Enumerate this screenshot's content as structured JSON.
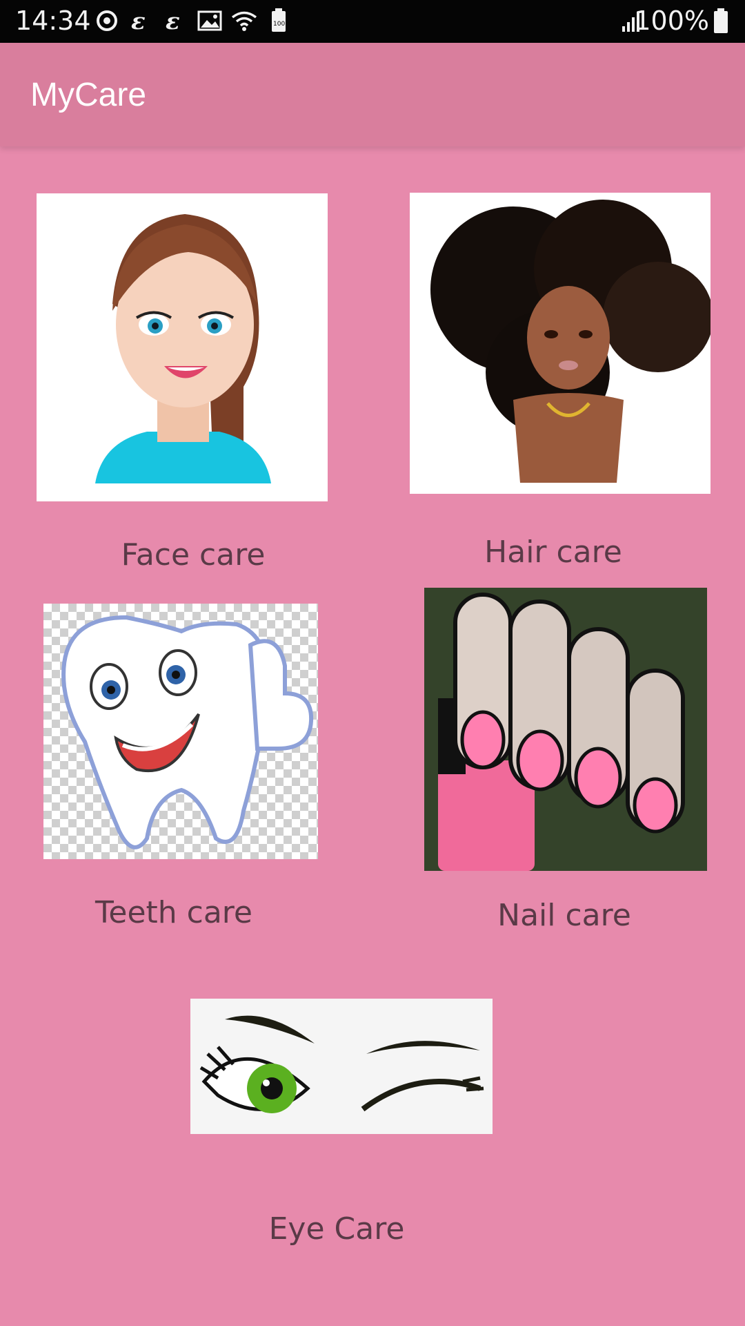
{
  "status_bar": {
    "time": "14:34",
    "battery_percent": "100%",
    "left_icons": [
      "sync-icon",
      "e-icon",
      "e-icon",
      "image-icon",
      "wifi-icon",
      "battery-saver-icon"
    ],
    "right_icons": [
      "signal-icon",
      "battery-icon"
    ]
  },
  "app_bar": {
    "title": "MyCare",
    "color": "#d97e9d"
  },
  "background_color": "#e78aac",
  "tiles": [
    {
      "label": "Face care",
      "image": "woman-face-illustration"
    },
    {
      "label": "Hair care",
      "image": "afro-hair-illustration"
    },
    {
      "label": "Teeth care",
      "image": "cartoon-tooth-thumbs-up"
    },
    {
      "label": "Nail care",
      "image": "pink-painted-nails-photo"
    },
    {
      "label": "Eye Care",
      "image": "winking-eye-illustration"
    }
  ]
}
